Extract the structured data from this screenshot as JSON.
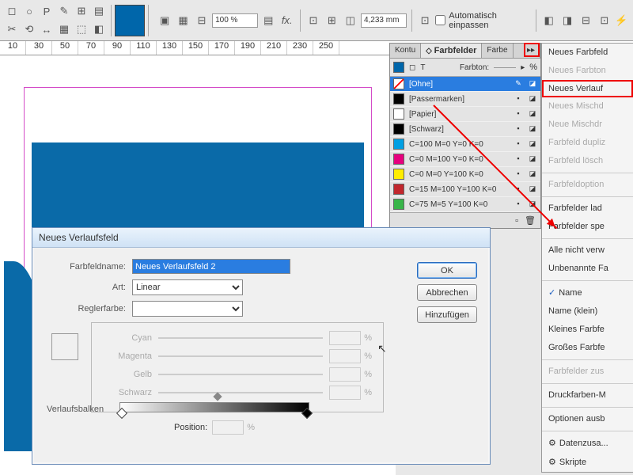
{
  "toolbar": {
    "zoom": "100 %",
    "measure": "4,233 mm",
    "autofit": "Automatisch einpassen"
  },
  "ruler": [
    "10",
    "30",
    "50",
    "70",
    "90",
    "110",
    "130",
    "150",
    "170",
    "190",
    "210",
    "230",
    "250"
  ],
  "panel": {
    "tabs": {
      "kontur": "Kontu",
      "farbfelder": "Farbfelder",
      "farbe": "Farbe"
    },
    "farbton_lbl": "Farbton:",
    "farbton_unit": "%",
    "swatches": [
      {
        "name": "[Ohne]",
        "color": "#fff",
        "none": true,
        "selected": true
      },
      {
        "name": "[Passermarken]",
        "color": "#000"
      },
      {
        "name": "[Papier]",
        "color": "#fff"
      },
      {
        "name": "[Schwarz]",
        "color": "#000"
      },
      {
        "name": "C=100 M=0 Y=0 K=0",
        "color": "#009fe3"
      },
      {
        "name": "C=0 M=100 Y=0 K=0",
        "color": "#e6007e"
      },
      {
        "name": "C=0 M=0 Y=100 K=0",
        "color": "#ffed00"
      },
      {
        "name": "C=15 M=100 Y=100 K=0",
        "color": "#c1272d"
      },
      {
        "name": "C=75 M=5 Y=100 K=0",
        "color": "#39b54a"
      }
    ]
  },
  "menu": {
    "items": [
      {
        "t": "Neues Farbfeld"
      },
      {
        "t": "Neues Farbton",
        "d": true
      },
      {
        "t": "Neues Verlauf",
        "hl": true
      },
      {
        "t": "Neues Mischd",
        "d": true
      },
      {
        "t": "Neue Mischdr",
        "d": true
      },
      {
        "t": "Farbfeld dupliz",
        "d": true
      },
      {
        "t": "Farbfeld lösch",
        "d": true
      },
      {
        "sep": true
      },
      {
        "t": "Farbfeldoption",
        "d": true
      },
      {
        "sep": true
      },
      {
        "t": "Farbfelder lad"
      },
      {
        "t": "Farbfelder spe"
      },
      {
        "sep": true
      },
      {
        "t": "Alle nicht verw"
      },
      {
        "t": "Unbenannte Fa"
      },
      {
        "sep": true
      },
      {
        "t": "Name",
        "chk": true
      },
      {
        "t": "Name (klein)"
      },
      {
        "t": "Kleines Farbfe"
      },
      {
        "t": "Großes Farbfe"
      },
      {
        "sep": true
      },
      {
        "t": "Farbfelder zus",
        "d": true
      },
      {
        "sep": true
      },
      {
        "t": "Druckfarben-M"
      },
      {
        "sep": true
      },
      {
        "t": "Optionen ausb"
      },
      {
        "sep": true
      },
      {
        "t": "Datenzusa...",
        "ico": true
      },
      {
        "t": "Skripte",
        "ico": true
      }
    ]
  },
  "dialog": {
    "title": "Neues Verlaufsfeld",
    "lbl_name": "Farbfeldname:",
    "val_name": "Neues Verlaufsfeld 2",
    "lbl_art": "Art:",
    "val_art": "Linear",
    "lbl_regler": "Reglerfarbe:",
    "cmyk": {
      "c": "Cyan",
      "m": "Magenta",
      "y": "Gelb",
      "k": "Schwarz"
    },
    "pct": "%",
    "lbl_verlauf": "Verlaufsbalken",
    "lbl_pos": "Position:",
    "btn_ok": "OK",
    "btn_cancel": "Abbrechen",
    "btn_add": "Hinzufügen"
  }
}
